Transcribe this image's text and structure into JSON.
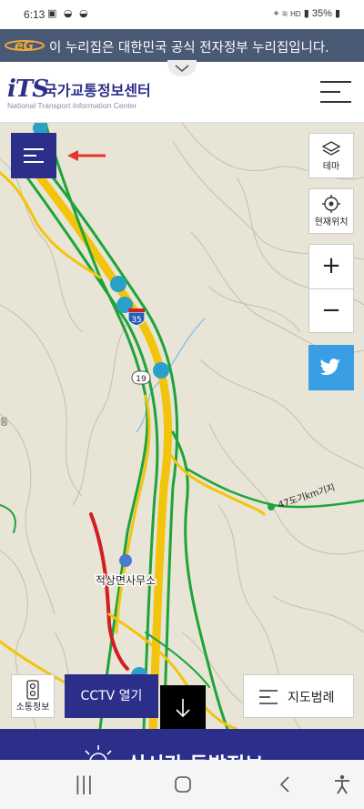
{
  "status_bar": {
    "time": "6:13",
    "left_icons": [
      "image-icon",
      "bowl-icon",
      "bowl-icon"
    ],
    "right_text": "35%",
    "right_icons": [
      "location-icon",
      "wifi-icon",
      "hd-icon",
      "signal-icon",
      "battery-icon"
    ]
  },
  "gov_banner": {
    "text": "이 누리집은 대한민국 공식 전자정부 누리집입니다.",
    "logo_icon": "egov-logo"
  },
  "header": {
    "logo_mark": "iTS",
    "title": "국가교통정보센터",
    "subtitle": "National Transport Information Center",
    "collapse_icon": "chevron-down-icon",
    "menu_icon": "hamburger-icon"
  },
  "map": {
    "route_labels": [
      "35",
      "19"
    ],
    "place_label": "적상면사무소",
    "road_text": "47도기km기지",
    "left_edge_text": "등"
  },
  "controls": {
    "theme_label": "테마",
    "location_label": "현재위치",
    "zoom_in": "+",
    "zoom_out": "−"
  },
  "bottom_controls": {
    "signal_label": "소통정보",
    "cctv_label": "CCTV 열기",
    "legend_label": "지도범례"
  },
  "bottom_banner": {
    "text": "실시간 돌발정보"
  },
  "colors": {
    "brand": "#2c2f8a",
    "gov_banner": "#4a5a75",
    "twitter": "#3a9ee4",
    "road_green": "#1fa33a",
    "road_yellow": "#f2c40d",
    "road_red": "#d11f1f"
  }
}
